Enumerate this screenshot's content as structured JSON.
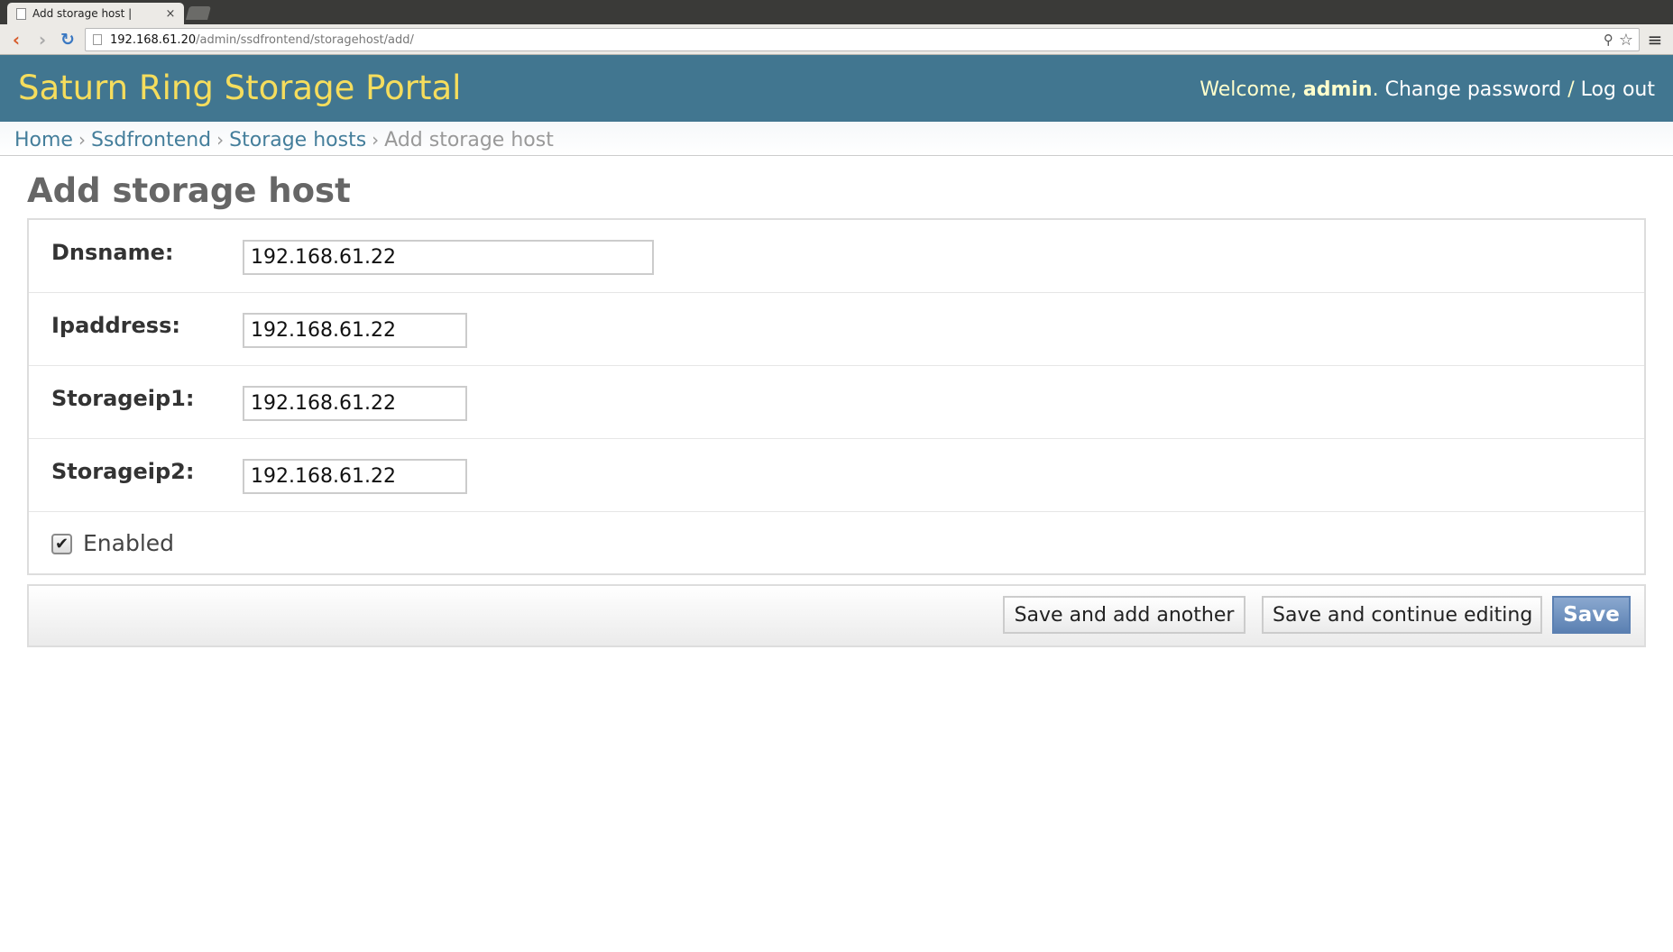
{
  "browser": {
    "tab_title": "Add storage host |",
    "tab_close": "×",
    "url_host": "192.168.61.20",
    "url_path": "/admin/ssdfrontend/storagehost/add/"
  },
  "header": {
    "site_title": "Saturn Ring Storage Portal",
    "welcome": "Welcome, ",
    "username": "admin",
    "dot": ". ",
    "change_password": "Change password",
    "slash": " / ",
    "log_out": "Log out"
  },
  "breadcrumbs": {
    "items": [
      "Home",
      "Ssdfrontend",
      "Storage hosts"
    ],
    "current": "Add storage host",
    "separator": "›"
  },
  "page_title": "Add storage host",
  "form": {
    "fields": [
      {
        "label": "Dnsname:",
        "value": "192.168.61.22"
      },
      {
        "label": "Ipaddress:",
        "value": "192.168.61.22"
      },
      {
        "label": "Storageip1:",
        "value": "192.168.61.22"
      },
      {
        "label": "Storageip2:",
        "value": "192.168.61.22"
      }
    ],
    "enabled": {
      "label": "Enabled",
      "checked": true,
      "check_glyph": "✔"
    }
  },
  "buttons": {
    "save_add_another": "Save and add another",
    "save_continue": "Save and continue editing",
    "save": "Save"
  },
  "colors": {
    "header_bg": "#417690",
    "site_title": "#f5dd5d",
    "link": "#447e9b",
    "save_button": "#5b80b2"
  }
}
